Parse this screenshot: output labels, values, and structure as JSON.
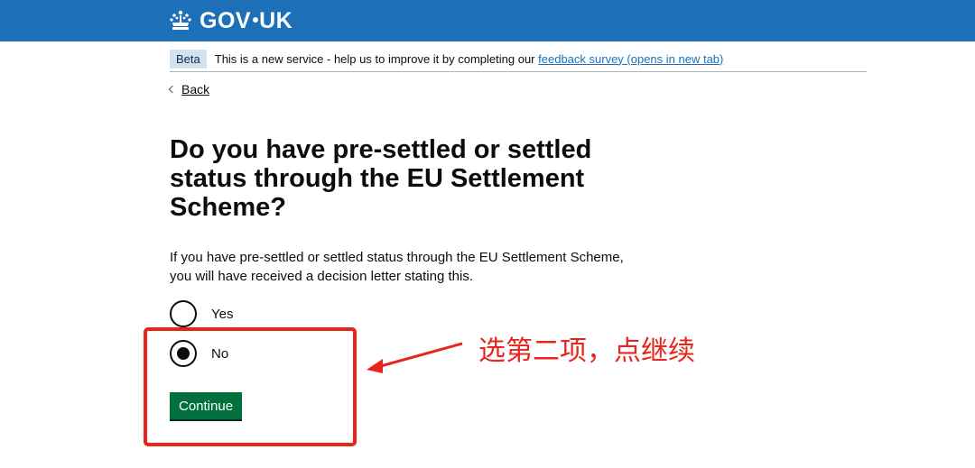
{
  "header": {
    "logo_text_left": "GOV",
    "logo_text_right": "UK",
    "logo_icon": "crown-icon",
    "background_color": "#1d70b8"
  },
  "phase_banner": {
    "tag": "Beta",
    "text": "This is a new service - help us to improve it by completing our",
    "link": "feedback survey (opens in new tab)"
  },
  "back_link": {
    "label": "Back",
    "icon": "chevron-left-icon"
  },
  "question": {
    "heading": "Do you have pre-settled or settled status through the EU Settlement Scheme?",
    "hint": "If you have pre-settled or settled status through the EU Settlement Scheme, you will have received a decision letter stating this.",
    "options": [
      {
        "label": "Yes",
        "selected": false
      },
      {
        "label": "No",
        "selected": true
      }
    ]
  },
  "continue_button": {
    "label": "Continue",
    "color": "#00703c"
  },
  "annotation": {
    "text": "选第二项，点继续",
    "color": "#e8241c"
  }
}
